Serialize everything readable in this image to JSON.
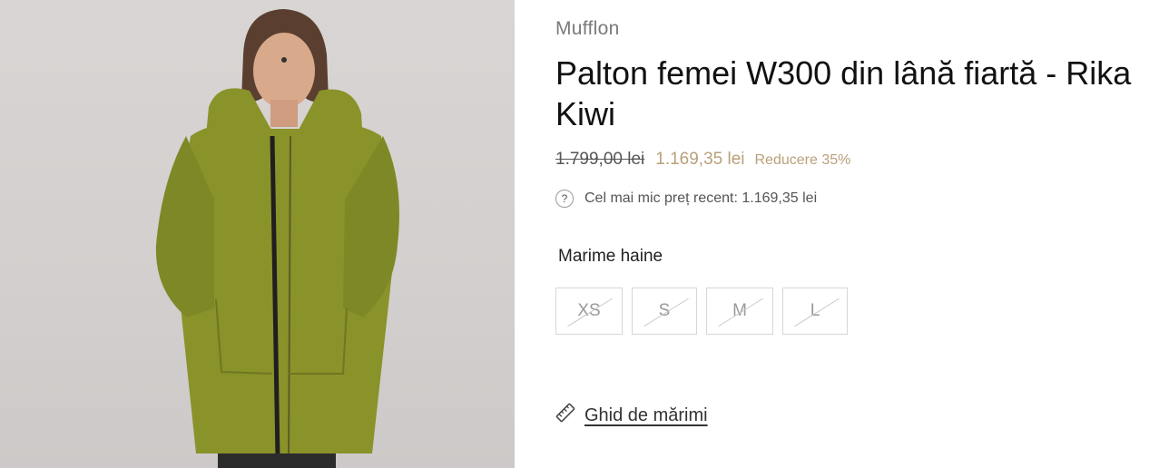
{
  "product": {
    "image_alt": "Woman wearing green boiled wool hooded coat",
    "brand": "Mufflon",
    "title": "Palton femei W300 din lână fiartă - Rika Kiwi",
    "old_price": "1.799,00 lei",
    "price": "1.169,35 lei",
    "discount": "Reducere 35%",
    "lowest_price_info": "Cel mai mic preț recent: 1.169,35 lei",
    "size_label": "Marime haine",
    "sizes": [
      {
        "label": "XS",
        "available": false
      },
      {
        "label": "S",
        "available": false
      },
      {
        "label": "M",
        "available": false
      },
      {
        "label": "L",
        "available": false
      }
    ],
    "size_guide": "Ghid de mărimi"
  },
  "colors": {
    "accent": "#b9a07a",
    "coat": "#8a922a"
  },
  "icons": {
    "lowest_price": "question-circle-icon",
    "size_guide": "ruler-icon"
  }
}
